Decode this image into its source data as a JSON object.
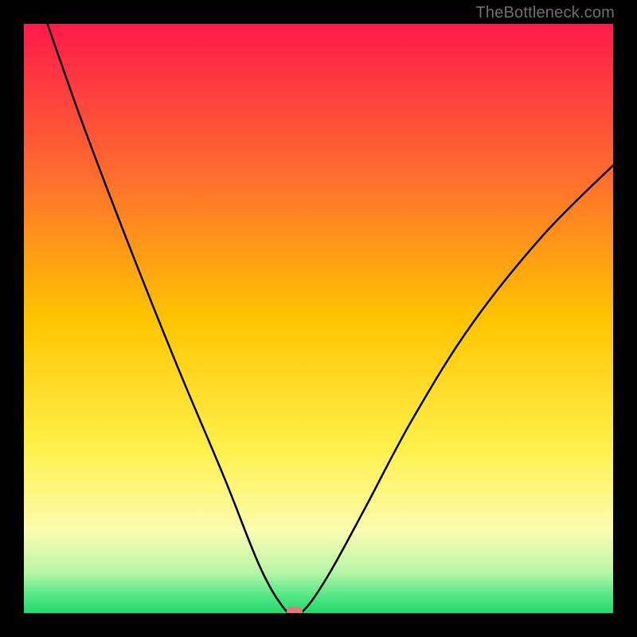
{
  "watermark": "TheBottleneck.com",
  "colors": {
    "frame": "#000000",
    "gradient_top": "#ff1a4b",
    "gradient_upper_mid": "#ff8a2a",
    "gradient_mid": "#ffd400",
    "gradient_lower_mid": "#f8fb8c",
    "gradient_green_light": "#8cf59a",
    "gradient_green": "#1fd96b",
    "curve": "#000000",
    "marker": "#e17878",
    "watermark_text": "#6f6f6f"
  },
  "chart_data": {
    "type": "line",
    "title": "",
    "xlabel": "",
    "ylabel": "",
    "x_range": [
      0,
      100
    ],
    "y_range": [
      0,
      100
    ],
    "notes": "V-shaped bottleneck curve. Left branch starts at top-left and descends steeply to a minimum; right branch rises with decreasing slope toward the right edge. Minimum and marker near x≈46, y≈0. Background is vertical rainbow gradient red→green.",
    "minimum_x": 46,
    "minimum_y": 0,
    "marker": {
      "x": 46,
      "y": 0
    },
    "series": [
      {
        "name": "bottleneck-curve",
        "points": [
          {
            "x": 4,
            "y": 100
          },
          {
            "x": 10,
            "y": 83
          },
          {
            "x": 18,
            "y": 62
          },
          {
            "x": 26,
            "y": 42
          },
          {
            "x": 34,
            "y": 23
          },
          {
            "x": 40,
            "y": 8
          },
          {
            "x": 44,
            "y": 1
          },
          {
            "x": 46,
            "y": 0
          },
          {
            "x": 48,
            "y": 1
          },
          {
            "x": 52,
            "y": 7
          },
          {
            "x": 58,
            "y": 18
          },
          {
            "x": 66,
            "y": 33
          },
          {
            "x": 76,
            "y": 49
          },
          {
            "x": 88,
            "y": 64
          },
          {
            "x": 100,
            "y": 76
          }
        ]
      }
    ],
    "background_gradient_stops": [
      {
        "offset": 0.0,
        "color": "#ff1a4b"
      },
      {
        "offset": 0.25,
        "color": "#ff6a2f"
      },
      {
        "offset": 0.5,
        "color": "#ffc400"
      },
      {
        "offset": 0.72,
        "color": "#fff04a"
      },
      {
        "offset": 0.86,
        "color": "#fbfcb0"
      },
      {
        "offset": 0.93,
        "color": "#b8f6a8"
      },
      {
        "offset": 0.965,
        "color": "#5fe98a"
      },
      {
        "offset": 1.0,
        "color": "#1fd96b"
      }
    ]
  }
}
